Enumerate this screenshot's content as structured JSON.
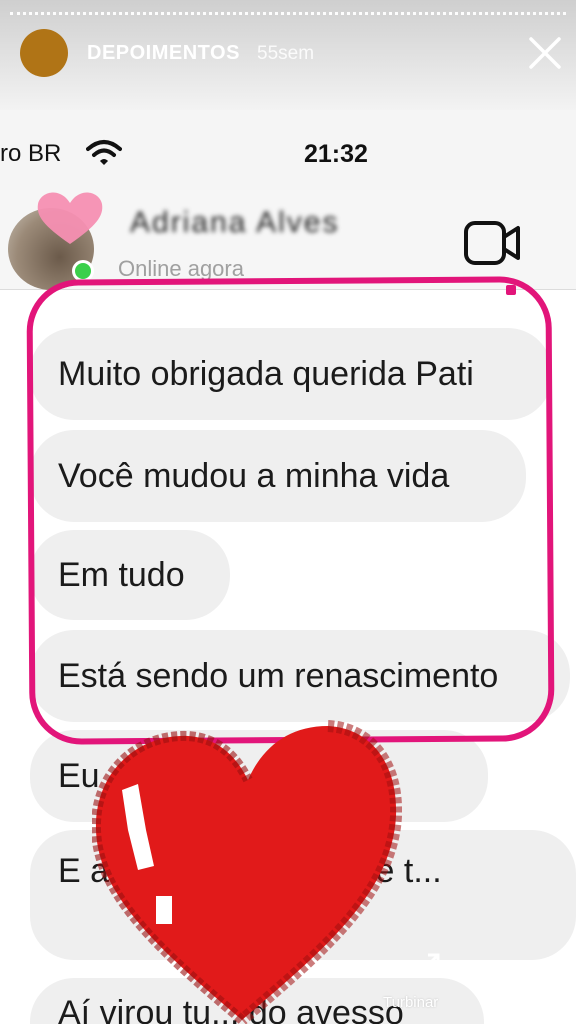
{
  "story": {
    "username": "DEPOIMENTOS",
    "time_ago": "55sem",
    "boost_label": "Turbinar"
  },
  "phone": {
    "carrier": "ro BR",
    "time": "21:32"
  },
  "chat": {
    "contact_name": "Adriana Alves",
    "status": "Online agora"
  },
  "messages": [
    {
      "text": "Muito obrigada querida Pati"
    },
    {
      "text": "Você mudou a minha vida"
    },
    {
      "text": "Em tudo"
    },
    {
      "text": "Está sendo um renascimento"
    },
    {
      "text": "Eu ... tudo"
    },
    {
      "text": "E a ... aquelas coi que t..."
    },
    {
      "text": "Aí virou tu... do avesso"
    }
  ],
  "colors": {
    "highlight_outline": "#e2157a",
    "sticker_heart": "#e11a1a",
    "online_dot": "#3bd04b",
    "bubble": "#efefef"
  },
  "icons": [
    "close-icon",
    "wifi-icon",
    "video-call-icon",
    "heart-sticker-icon",
    "boost-icon",
    "more-options-icon"
  ]
}
